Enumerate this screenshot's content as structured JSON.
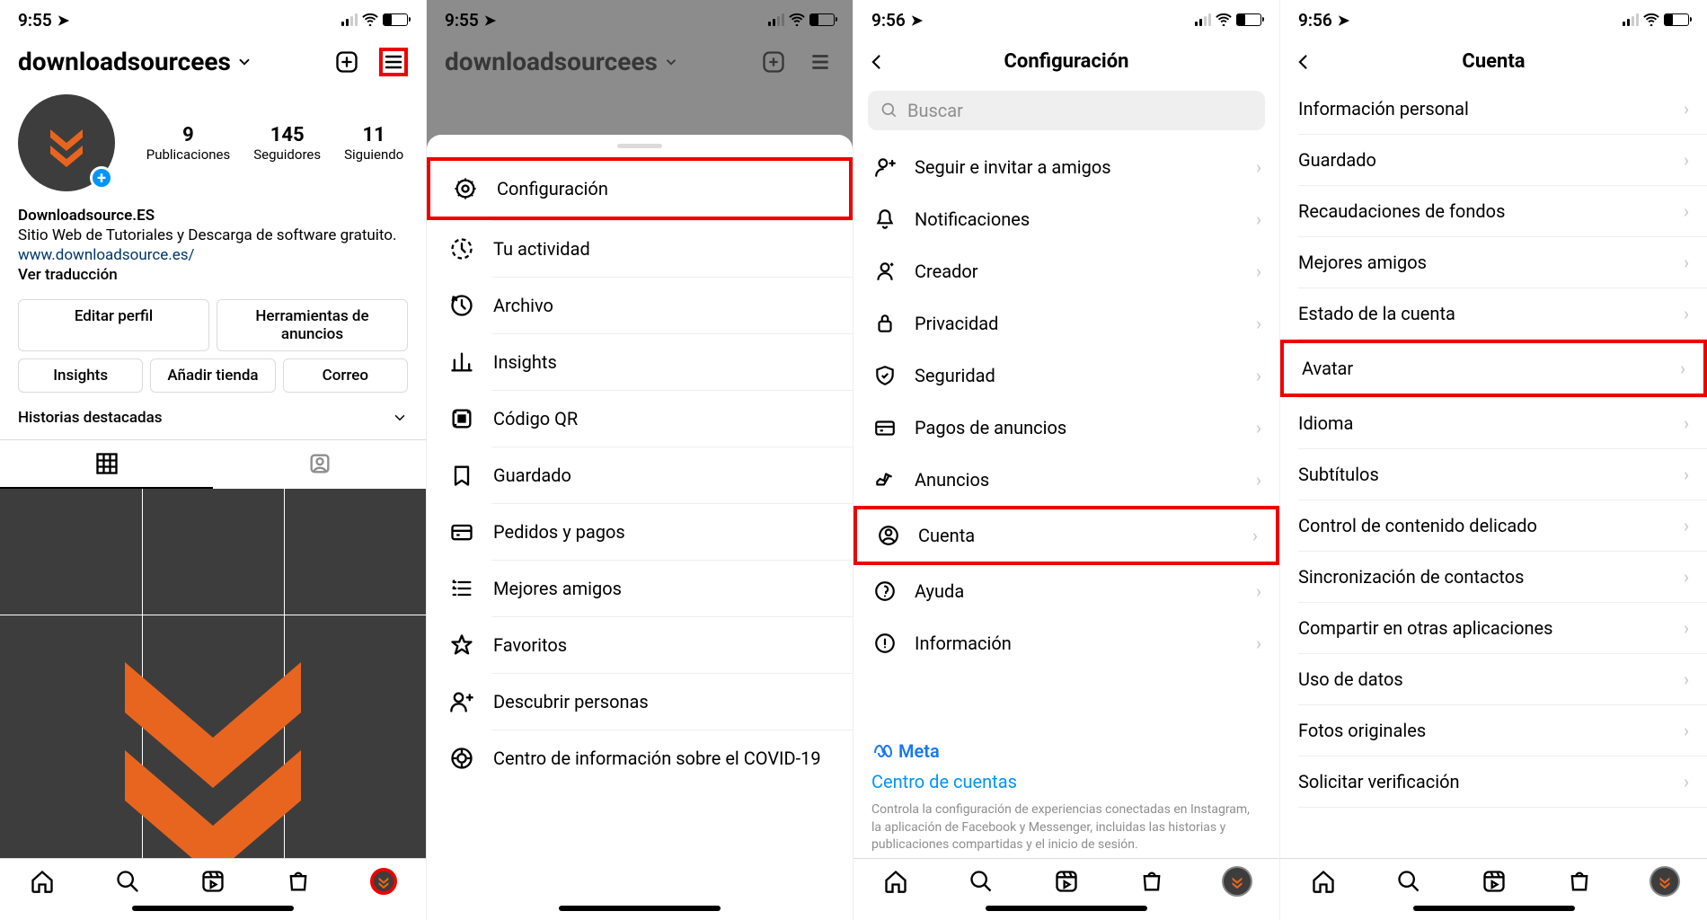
{
  "status": {
    "time1": "9:55",
    "time2": "9:56"
  },
  "screen1": {
    "username": "downloadsourcees",
    "stats": {
      "posts": "9",
      "posts_label": "Publicaciones",
      "followers": "145",
      "followers_label": "Seguidores",
      "following": "11",
      "following_label": "Siguiendo"
    },
    "bio": {
      "name": "Downloadsource.ES",
      "desc": "Sitio Web de Tutoriales y Descarga de software gratuito.",
      "link": "www.downloadsource.es/",
      "translate": "Ver traducción"
    },
    "buttons": {
      "edit": "Editar perfil",
      "ads": "Herramientas de anuncios",
      "insights": "Insights",
      "shop": "Añadir tienda",
      "email": "Correo"
    },
    "highlights": "Historias destacadas"
  },
  "screen2": {
    "username": "downloadsourcees",
    "menu": [
      "Configuración",
      "Tu actividad",
      "Archivo",
      "Insights",
      "Código QR",
      "Guardado",
      "Pedidos y pagos",
      "Mejores amigos",
      "Favoritos",
      "Descubrir personas",
      "Centro de información sobre el COVID-19"
    ]
  },
  "screen3": {
    "title": "Configuración",
    "search": "Buscar",
    "items": [
      "Seguir e invitar a amigos",
      "Notificaciones",
      "Creador",
      "Privacidad",
      "Seguridad",
      "Pagos de anuncios",
      "Anuncios",
      "Cuenta",
      "Ayuda",
      "Información"
    ],
    "meta_brand": "Meta",
    "meta_link": "Centro de cuentas",
    "meta_desc": "Controla la configuración de experiencias conectadas en Instagram, la aplicación de Facebook y Messenger, incluidas las historias y publicaciones compartidas y el inicio de sesión."
  },
  "screen4": {
    "title": "Cuenta",
    "items": [
      "Información personal",
      "Guardado",
      "Recaudaciones de fondos",
      "Mejores amigos",
      "Estado de la cuenta",
      "Avatar",
      "Idioma",
      "Subtítulos",
      "Control de contenido delicado",
      "Sincronización de contactos",
      "Compartir en otras aplicaciones",
      "Uso de datos",
      "Fotos originales",
      "Solicitar verificación"
    ]
  }
}
